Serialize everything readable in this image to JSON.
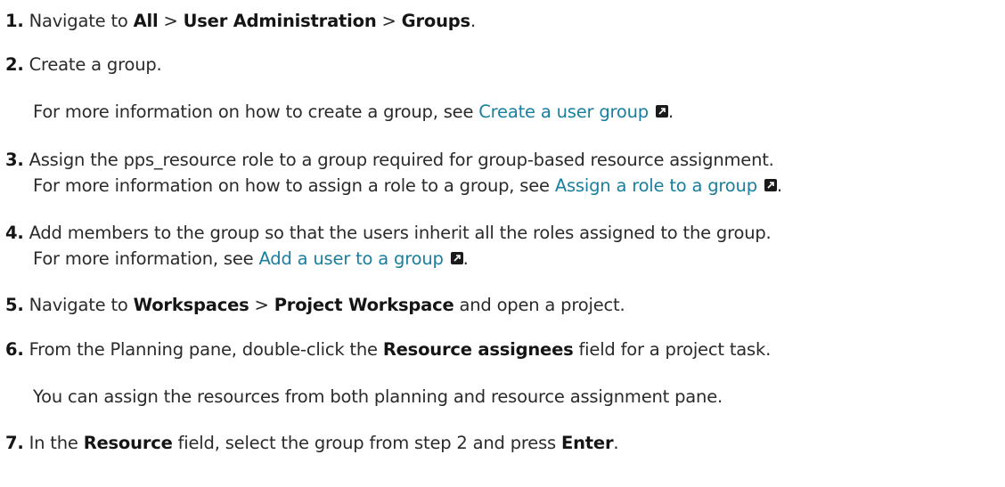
{
  "steps": [
    {
      "num": "1.",
      "t1": "Navigate to ",
      "b1": "All",
      "t2": " > ",
      "b2": "User Administration",
      "t3": " > ",
      "b3": "Groups",
      "t4": "."
    },
    {
      "num": "2.",
      "text": "Create a group.",
      "note_prefix": "For more information on how to create a group, see ",
      "link": "Create a user group",
      "note_suffix": "."
    },
    {
      "num": "3.",
      "line1": "Assign the pps_resource role to a group required for group-based resource assignment.",
      "line2_prefix": "For more information on how to assign a role to a group, see ",
      "link": "Assign a role to a group",
      "line2_suffix": "."
    },
    {
      "num": "4.",
      "line1": "Add members to the group so that the users inherit all the roles assigned to the group.",
      "line2_prefix": "For more information, see ",
      "link": "Add a user to a group",
      "line2_suffix": "."
    },
    {
      "num": "5.",
      "t1": "Navigate to ",
      "b1": "Workspaces",
      "t2": " > ",
      "b2": "Project Workspace",
      "t3": " and open a project."
    },
    {
      "num": "6.",
      "t1": "From the Planning pane, double-click the ",
      "b1": "Resource assignees",
      "t2": " field for a project task.",
      "note": "You can assign the resources from both planning and resource assignment pane."
    },
    {
      "num": "7.",
      "t1": "In the ",
      "b1": "Resource",
      "t2": " field, select the group from step 2 and press ",
      "b2": "Enter",
      "t3": "."
    }
  ]
}
